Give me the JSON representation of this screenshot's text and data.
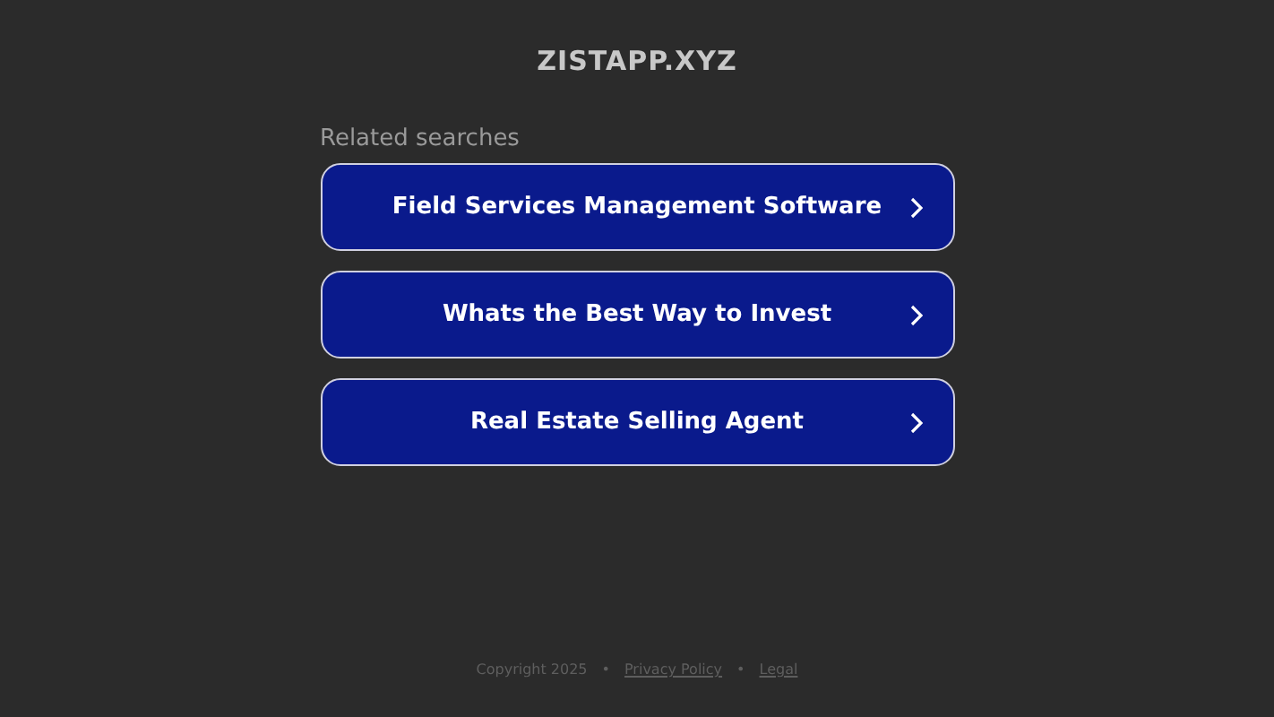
{
  "site_title": "ZISTAPP.XYZ",
  "section_heading": "Related searches",
  "searches": [
    {
      "label": "Field Services Management Software"
    },
    {
      "label": "Whats the Best Way to Invest"
    },
    {
      "label": "Real Estate Selling Agent"
    }
  ],
  "footer": {
    "copyright": "Copyright 2025",
    "separator": "•",
    "links": [
      "Privacy Policy",
      "Legal"
    ]
  }
}
